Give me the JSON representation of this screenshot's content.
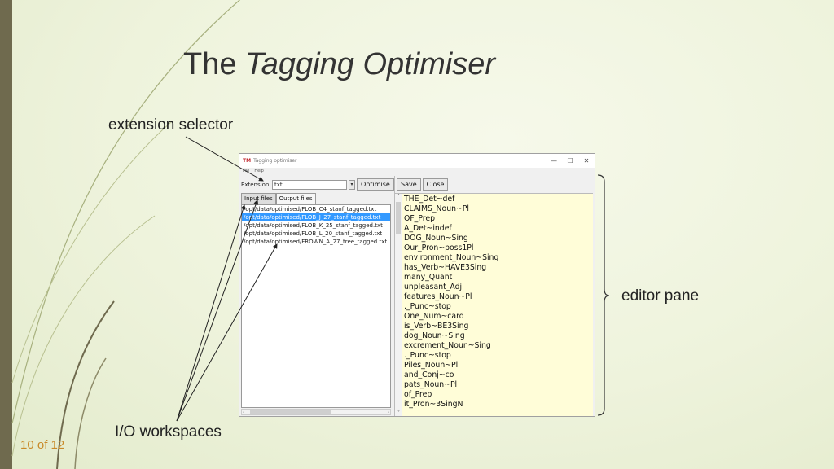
{
  "slide": {
    "title_plain": "The",
    "title_italic": "Tagging Optimiser",
    "callouts": {
      "extension_selector": "extension selector",
      "editor_pane": "editor pane",
      "io_workspaces": "I/O workspaces"
    },
    "slide_number": "10 of 12",
    "colors": {
      "left_bar": "#6f6a4e",
      "slide_number": "#c98a2a"
    }
  },
  "window": {
    "app_icon": "TM",
    "title": "Tagging optimiser",
    "menu": [
      "File",
      "Help"
    ],
    "controls": {
      "minimize": "—",
      "maximize": "☐",
      "close": "✕"
    },
    "extension": {
      "label": "Extension",
      "value": "txt",
      "dropdown_icon": "chevron-down-icon"
    },
    "optimise_label": "Optimise",
    "tabs": [
      {
        "label": "Input files",
        "selected": true
      },
      {
        "label": "Output files",
        "selected": false
      }
    ],
    "files": [
      {
        "path": "/opt/data/optimised/FLOB_C4_stanf_tagged.txt",
        "selected": false
      },
      {
        "path": "/opt/data/optimised/FLOB_J_27_stanf_tagged.txt",
        "selected": true
      },
      {
        "path": "/opt/data/optimised/FLOB_K_25_stanf_tagged.txt",
        "selected": false
      },
      {
        "path": "/opt/data/optimised/FLOB_L_20_stanf_tagged.txt",
        "selected": false
      },
      {
        "path": "/opt/data/optimised/FROWN_A_27_tree_tagged.txt",
        "selected": false
      }
    ],
    "editor": {
      "save_label": "Save",
      "close_label": "Close",
      "lines": [
        "THE_Det~def",
        "CLAIMS_Noun~Pl",
        "OF_Prep",
        "A_Det~indef",
        "DOG_Noun~Sing",
        "Our_Pron~poss1Pl",
        "environment_Noun~Sing",
        "has_Verb~HAVE3Sing",
        "many_Quant",
        "unpleasant_Adj",
        "features_Noun~Pl",
        "._Punc~stop",
        "One_Num~card",
        "is_Verb~BE3Sing",
        "dog_Noun~Sing",
        "excrement_Noun~Sing",
        "._Punc~stop",
        "Piles_Noun~Pl",
        "and_Conj~co",
        "pats_Noun~Pl",
        "of_Prep",
        "it_Pron~3SingN"
      ]
    }
  }
}
